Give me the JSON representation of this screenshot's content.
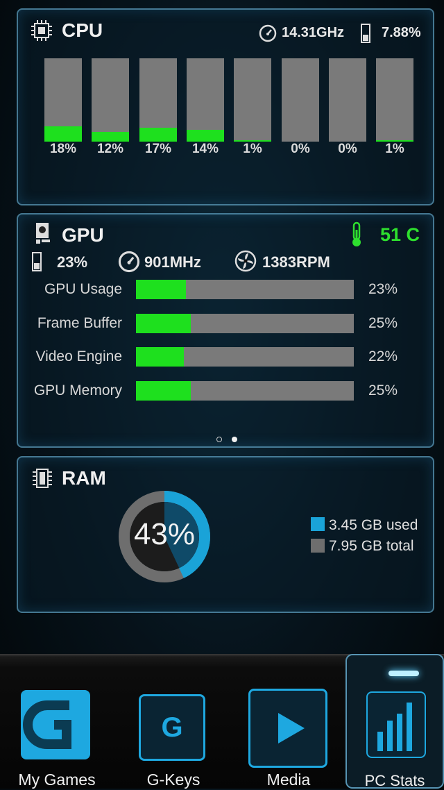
{
  "cpu": {
    "title": "CPU",
    "clock": "14.31GHz",
    "usage": "7.88%",
    "cores": [
      {
        "label": "18%",
        "value": 18
      },
      {
        "label": "12%",
        "value": 12
      },
      {
        "label": "17%",
        "value": 17
      },
      {
        "label": "14%",
        "value": 14
      },
      {
        "label": "1%",
        "value": 1
      },
      {
        "label": "0%",
        "value": 0
      },
      {
        "label": "0%",
        "value": 0
      },
      {
        "label": "1%",
        "value": 1
      }
    ]
  },
  "gpu": {
    "title": "GPU",
    "temperature": "51 C",
    "usage": "23%",
    "clock": "901MHz",
    "fan": "1383RPM",
    "metrics": [
      {
        "label": "GPU Usage",
        "value_text": "23%",
        "value": 23
      },
      {
        "label": "Frame Buffer",
        "value_text": "25%",
        "value": 25
      },
      {
        "label": "Video Engine",
        "value_text": "22%",
        "value": 22
      },
      {
        "label": "GPU Memory",
        "value_text": "25%",
        "value": 25
      }
    ],
    "pager": {
      "pages": 2,
      "active": 2
    }
  },
  "ram": {
    "title": "RAM",
    "percent_text": "43%",
    "percent": 43,
    "used": "3.45 GB used",
    "total": "7.95 GB total"
  },
  "colors": {
    "bar_fill": "#1ee01e",
    "bar_track": "#7a7a7a",
    "temp": "#2ee02e",
    "ram_used": "#1aa3d8",
    "ram_total": "#6e6e6e",
    "accent": "#1ea8e0"
  },
  "nav": {
    "tabs": [
      {
        "label": "My Games",
        "icon": "logitech-g-icon"
      },
      {
        "label": "G-Keys",
        "icon": "g-key-icon"
      },
      {
        "label": "Media",
        "icon": "play-icon"
      },
      {
        "label": "PC Stats",
        "icon": "bar-graph-icon",
        "active": true
      }
    ]
  }
}
